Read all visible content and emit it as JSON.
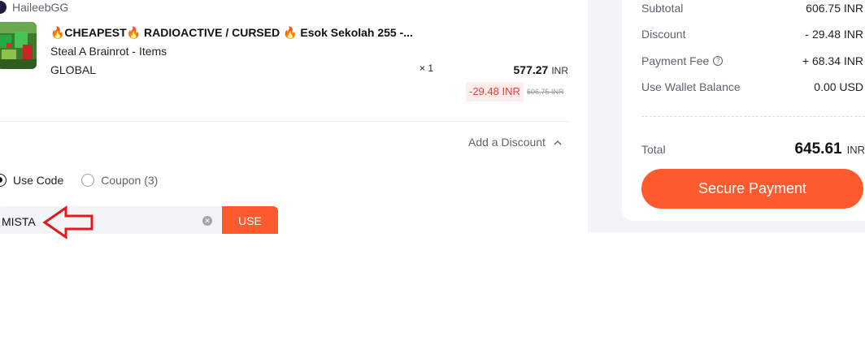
{
  "seller": {
    "name": "HaileebGG"
  },
  "product": {
    "title": "🔥CHEAPEST🔥 RADIOACTIVE / CURSED 🔥 Esok Sekolah 255 -...",
    "subtitle": "Steal A Brainrot - Items",
    "region": "GLOBAL",
    "quantity": "× 1",
    "price": "577.27",
    "currency": "INR",
    "discount": "-29.48 INR",
    "original_price": "606.75 INR"
  },
  "discount_section": {
    "toggle_label": "Add a Discount",
    "options": [
      {
        "label": "Use Code",
        "selected": true
      },
      {
        "label": "Coupon (3)",
        "selected": false
      }
    ],
    "code_value": "MISTA",
    "use_button": "USE"
  },
  "summary": {
    "rows": [
      {
        "label": "Subtotal",
        "value": "606.75 INR"
      },
      {
        "label": "Discount",
        "value": "- 29.48 INR"
      },
      {
        "label": "Payment Fee",
        "value": "+ 68.34 INR"
      },
      {
        "label": "Use Wallet Balance",
        "value": "0.00 USD"
      }
    ],
    "total_label": "Total",
    "total_amount": "645.61",
    "total_currency": "INR",
    "pay_button": "Secure Payment"
  },
  "colors": {
    "accent": "#fe5a2d",
    "discount_red": "#e8403a",
    "annotation_arrow": "#e0191d"
  }
}
